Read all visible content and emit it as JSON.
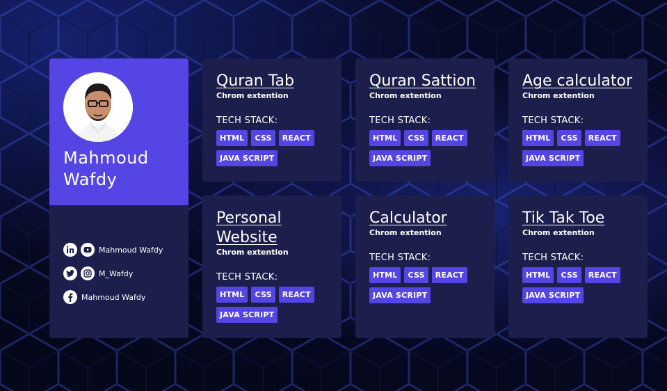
{
  "profile": {
    "name_first": "Mahmoud",
    "name_last": "Wafdy",
    "socials": [
      {
        "icons": [
          "linkedin-icon",
          "youtube-icon"
        ],
        "label": "Mahmoud Wafdy"
      },
      {
        "icons": [
          "twitter-icon",
          "instagram-icon"
        ],
        "label": "M_Wafdy"
      },
      {
        "icons": [
          "facebook-icon"
        ],
        "label": "Mahmoud Wafdy"
      }
    ]
  },
  "colors": {
    "accent": "#5545e4",
    "card": "#1c1f4c",
    "background": "#06081a"
  },
  "projects": [
    {
      "title": "Quran Tab",
      "subtitle": "Chrom extention",
      "stack_label": "TECH STACK:",
      "tags": [
        "HTML",
        "CSS",
        "REACT",
        "JAVA SCRIPT"
      ]
    },
    {
      "title": "Quran Sattion",
      "subtitle": "Chrom extention",
      "stack_label": "TECH STACK:",
      "tags": [
        "HTML",
        "CSS",
        "REACT",
        "JAVA SCRIPT"
      ]
    },
    {
      "title": "Age calculator",
      "subtitle": "Chrom extention",
      "stack_label": "TECH STACK:",
      "tags": [
        "HTML",
        "CSS",
        "REACT",
        "JAVA SCRIPT"
      ]
    },
    {
      "title": "Personal Website",
      "subtitle": "Chrom extention",
      "stack_label": "TECH STACK:",
      "tags": [
        "HTML",
        "CSS",
        "REACT",
        "JAVA SCRIPT"
      ]
    },
    {
      "title": "Calculator",
      "subtitle": "Chrom extention",
      "stack_label": "TECH STACK:",
      "tags": [
        "HTML",
        "CSS",
        "REACT",
        "JAVA SCRIPT"
      ]
    },
    {
      "title": "Tik Tak Toe",
      "subtitle": "Chrom extention",
      "stack_label": "TECH STACK:",
      "tags": [
        "HTML",
        "CSS",
        "REACT",
        "JAVA SCRIPT"
      ]
    }
  ]
}
